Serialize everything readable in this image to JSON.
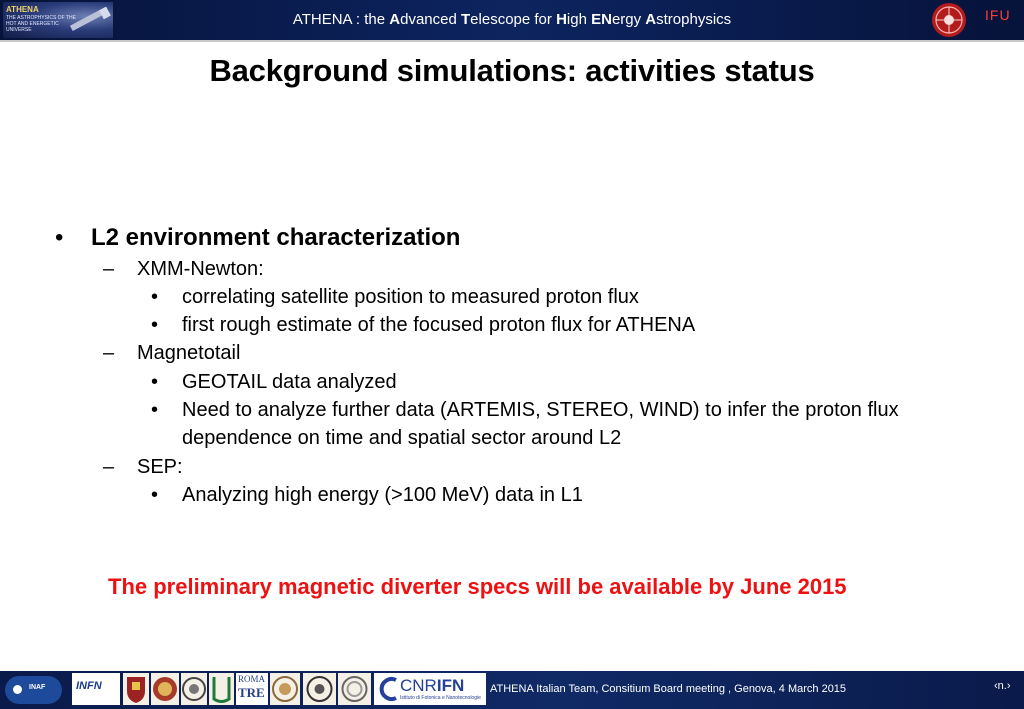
{
  "header": {
    "title_parts": [
      {
        "t": "ATHENA : the ",
        "b": false
      },
      {
        "t": "A",
        "b": true
      },
      {
        "t": "dvanced ",
        "b": false
      },
      {
        "t": "T",
        "b": true
      },
      {
        "t": "elescope for ",
        "b": false
      },
      {
        "t": "H",
        "b": true
      },
      {
        "t": "igh ",
        "b": false
      },
      {
        "t": "EN",
        "b": true
      },
      {
        "t": "ergy ",
        "b": false
      },
      {
        "t": "A",
        "b": true
      },
      {
        "t": "strophysics",
        "b": false
      }
    ],
    "left_logo": {
      "name": "ATHENA",
      "subtitle": "THE ASTROPHYSICS OF THE HOT AND ENERGETIC UNIVERSE"
    },
    "right_logo": {
      "name": "IFU"
    }
  },
  "slide": {
    "title": "Background simulations: activities status",
    "bullets": {
      "b1": "L2 environment characterization",
      "b1_1": "XMM-Newton:",
      "b1_1_1": "correlating satellite position to measured proton flux",
      "b1_1_2": "first rough estimate of the focused proton flux for ATHENA",
      "b1_2": "Magnetotail",
      "b1_2_1": "GEOTAIL data analyzed",
      "b1_2_2a": "Need to analyze further data (ARTEMIS, STEREO, WIND) to infer the proton flux",
      "b1_2_2b": "dependence on time and spatial sector around L2",
      "b1_3": "SEP:",
      "b1_3_1": "Analyzing high energy (>100 MeV) data in L1"
    },
    "bullet_glyphs": {
      "dot": "•",
      "dash": "–"
    },
    "highlight": "The preliminary magnetic diverter specs will be available by June 2015",
    "highlight_color": "#ee1111"
  },
  "footer": {
    "text": "ATHENA Italian Team, Consitium Board meeting , Genova, 4 March 2015",
    "page": "‹n.›",
    "logos": {
      "inaf": "INAF",
      "infn": "INFN",
      "roma_top": "ROMA",
      "roma_bottom": "TRE",
      "cnr": "CNR",
      "ifn": "IFN",
      "cnr_sub": "Istituto di Fotonica e Nanotecnologie"
    }
  },
  "colors": {
    "header_bg": "#0d2460",
    "footer_bg": "#102a66",
    "accent_red": "#ee1111"
  }
}
